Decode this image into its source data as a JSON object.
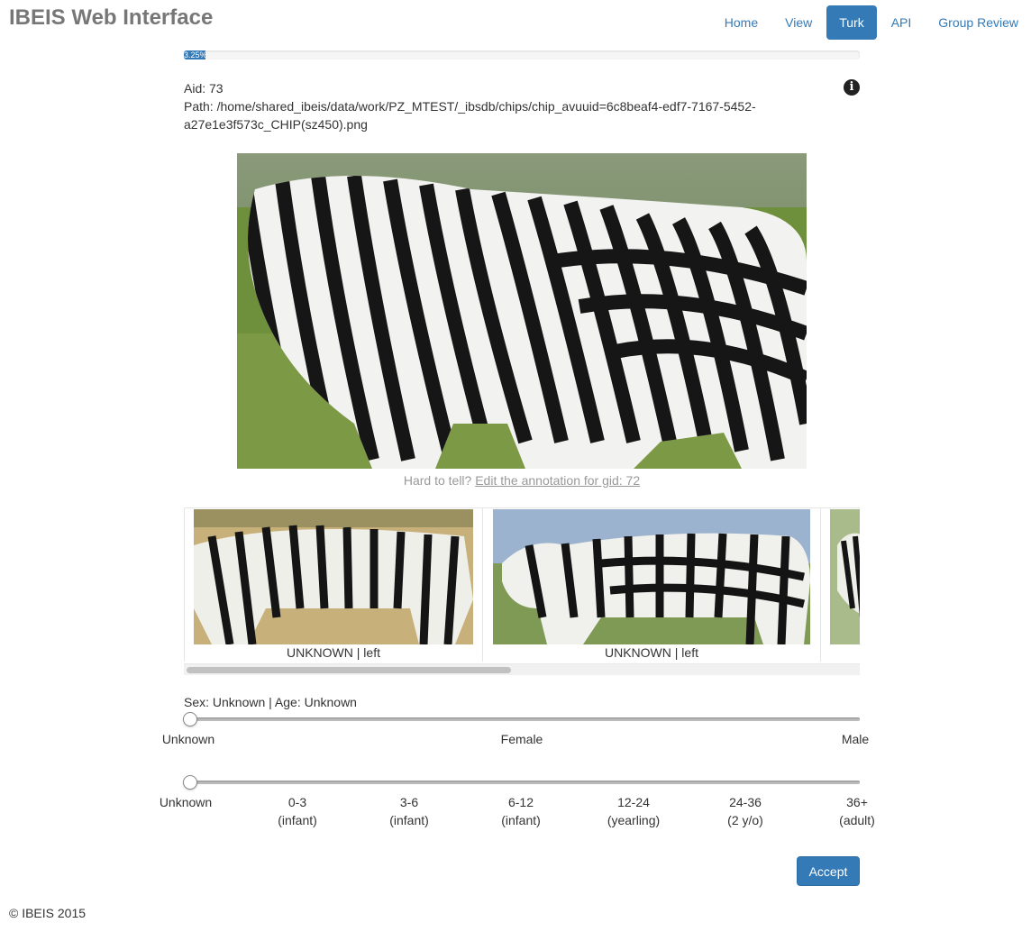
{
  "app": {
    "brand": "IBEIS Web Interface",
    "nav": [
      {
        "label": "Home",
        "active": false
      },
      {
        "label": "View",
        "active": false
      },
      {
        "label": "Turk",
        "active": true
      },
      {
        "label": "API",
        "active": false
      },
      {
        "label": "Group Review",
        "active": false
      }
    ]
  },
  "progress": {
    "label": "3.25%",
    "percent": 3.25
  },
  "annotation": {
    "aid_line": "Aid: 73",
    "path_line": "Path: /home/shared_ibeis/data/work/PZ_MTEST/_ibsdb/chips/chip_avuuid=6c8beaf4-edf7-7167-5452-a27e1e3f573c_CHIP(sz450).png"
  },
  "hint": {
    "prefix": "Hard to tell?",
    "link": "Edit the annotation for gid: 72"
  },
  "carousel": {
    "items": [
      {
        "caption": "UNKNOWN | left"
      },
      {
        "caption": "UNKNOWN | left"
      },
      {
        "caption": ""
      }
    ]
  },
  "summary": "Sex: Unknown | Age: Unknown",
  "sex_slider": {
    "value": 0,
    "labels": [
      "Unknown",
      "Female",
      "Male"
    ]
  },
  "age_slider": {
    "value": 0,
    "labels": [
      {
        "top": "Unknown",
        "bottom": ""
      },
      {
        "top": "0-3",
        "bottom": "(infant)"
      },
      {
        "top": "3-6",
        "bottom": "(infant)"
      },
      {
        "top": "6-12",
        "bottom": "(infant)"
      },
      {
        "top": "12-24",
        "bottom": "(yearling)"
      },
      {
        "top": "24-36",
        "bottom": "(2 y/o)"
      },
      {
        "top": "36+",
        "bottom": "(adult)"
      }
    ]
  },
  "accept_label": "Accept",
  "footer": "© IBEIS 2015",
  "icons": {
    "info": "info-circle-icon"
  },
  "colors": {
    "accent": "#337ab7"
  }
}
